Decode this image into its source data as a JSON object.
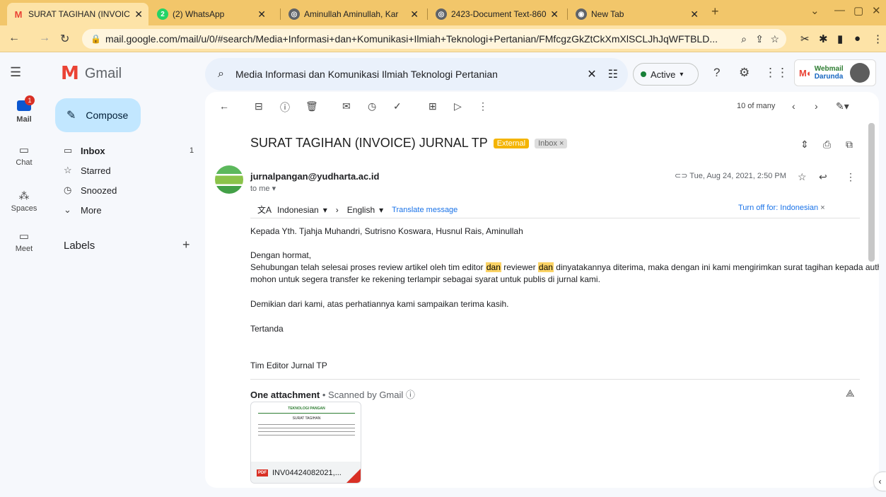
{
  "browser": {
    "tabs": [
      {
        "title": "SURAT TAGIHAN (INVOIC",
        "active": true
      },
      {
        "title": "(2) WhatsApp",
        "active": false
      },
      {
        "title": "Aminullah Aminullah, Kar",
        "active": false
      },
      {
        "title": "2423-Document Text-860",
        "active": false
      },
      {
        "title": "New Tab",
        "active": false
      }
    ],
    "url": "mail.google.com/mail/u/0/#search/Media+Informasi+dan+Komunikasi+Ilmiah+Teknologi+Pertanian/FMfcgzGkZtCkXmXlSCLJhJqWFTBLD...",
    "whatsapp_badge": "2"
  },
  "gmail": {
    "app_name": "Gmail",
    "search_query": "Media Informasi dan Komunikasi Ilmiah Teknologi Pertanian",
    "status": "Active",
    "brand_text": "Webmail",
    "brand_sub": "Darunda",
    "rail": [
      {
        "label": "Mail",
        "badge": "1"
      },
      {
        "label": "Chat"
      },
      {
        "label": "Spaces"
      },
      {
        "label": "Meet"
      }
    ],
    "compose_label": "Compose",
    "nav": [
      {
        "label": "Inbox",
        "count": "1"
      },
      {
        "label": "Starred",
        "count": ""
      },
      {
        "label": "Snoozed",
        "count": ""
      },
      {
        "label": "More",
        "count": ""
      }
    ],
    "labels_heading": "Labels",
    "pager": "10 of many"
  },
  "email": {
    "subject": "SURAT TAGIHAN (INVOICE) JURNAL TP",
    "badge_external": "External",
    "badge_inbox": "Inbox",
    "sender": "jurnalpangan@yudharta.ac.id",
    "to": "to me",
    "date": "Tue, Aug 24, 2021, 2:50 PM",
    "translate": {
      "from": "Indonesian",
      "to": "English",
      "action": "Translate message",
      "turn_off": "Turn off for: Indonesian"
    },
    "body": {
      "l1": "Kepada Yth. Tjahja Muhandri, Sutrisno Koswara, Husnul Rais, Aminullah",
      "l2": "Dengan hormat,",
      "l3a": "Sehubungan telah selesai proses review artikel oleh tim editor ",
      "l3b": "dan",
      "l3c": " reviewer ",
      "l3d": "dan",
      "l3e": " dinyatakannya diterima, maka dengan ini kami mengirimkan surat tagihan kepada author.",
      "l4": "mohon untuk segera transfer ke rekening terlampir sebagai syarat untuk publis di jurnal kami.",
      "l5": "Demikian dari kami, atas perhatiannya kami sampaikan terima kasih.",
      "l6": "Tertanda",
      "l7": "Tim Editor Jurnal TP"
    },
    "attachment": {
      "heading": "One attachment",
      "scan": "Scanned by Gmail",
      "filename": "INV04424082021,...",
      "file_type": "PDF",
      "preview_title": "TEKNOLOGI PANGAN",
      "preview_heading": "SURAT TAGIHAN"
    }
  },
  "colors": {
    "tabstrip": "#f2c66a",
    "compose": "#c2e7ff",
    "highlight": "#fbd365",
    "external_badge": "#f4b400"
  }
}
